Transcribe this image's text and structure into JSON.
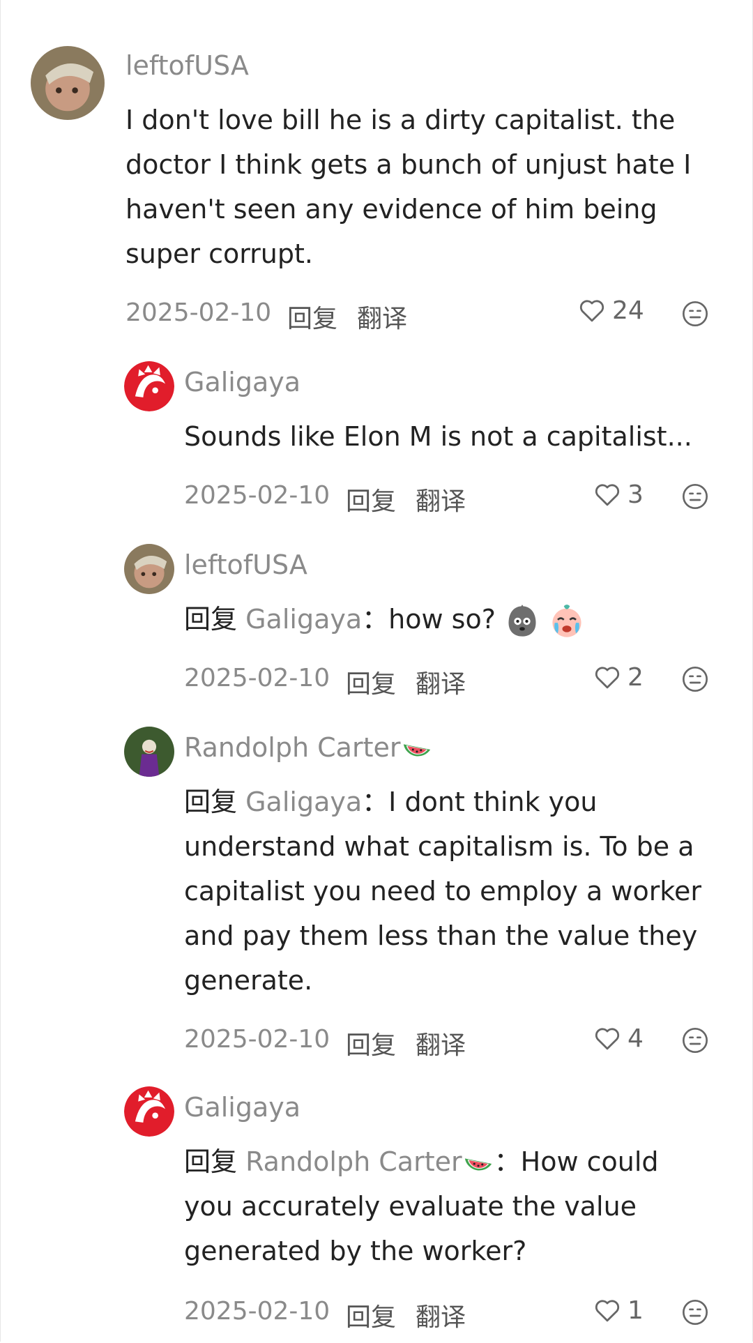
{
  "comments": [
    {
      "username": "leftofUSA",
      "text": "I don't love bill he is a dirty capitalist. the doctor I think gets a bunch of unjust hate I haven't seen any evidence of him being super corrupt.",
      "date": "2025-02-10",
      "reply_label": "回复",
      "translate_label": "翻译",
      "likes": "24"
    },
    {
      "username": "Galigaya",
      "text": "Sounds like Elon M is not a capitalist...",
      "date": "2025-02-10",
      "reply_label": "回复",
      "translate_label": "翻译",
      "likes": "3"
    },
    {
      "username": "leftofUSA",
      "reply_prefix": "回复",
      "reply_to": "Galigaya",
      "colon": "：",
      "text": "how so?",
      "date": "2025-02-10",
      "reply_label": "回复",
      "translate_label": "翻译",
      "likes": "2"
    },
    {
      "username": "Randolph Carter",
      "reply_prefix": "回复",
      "reply_to": "Galigaya",
      "colon": "：",
      "text": "I dont think you understand what capitalism is. To be a capitalist you need to employ a worker and pay them less than the value they generate.",
      "date": "2025-02-10",
      "reply_label": "回复",
      "translate_label": "翻译",
      "likes": "4"
    },
    {
      "username": "Galigaya",
      "reply_prefix": "回复",
      "reply_to": "Randolph Carter",
      "colon": "：",
      "text": "How could you accurately evaluate the value generated by the worker?",
      "date": "2025-02-10",
      "reply_label": "回复",
      "translate_label": "翻译",
      "likes": "1"
    }
  ],
  "icons": {
    "like": "heart-outline-icon",
    "dislike": "neutral-face-icon",
    "watermelon": "watermelon-emoji"
  },
  "colors": {
    "username": "#8a8a8a",
    "text": "#222222",
    "brand_red": "#e11d2b"
  }
}
